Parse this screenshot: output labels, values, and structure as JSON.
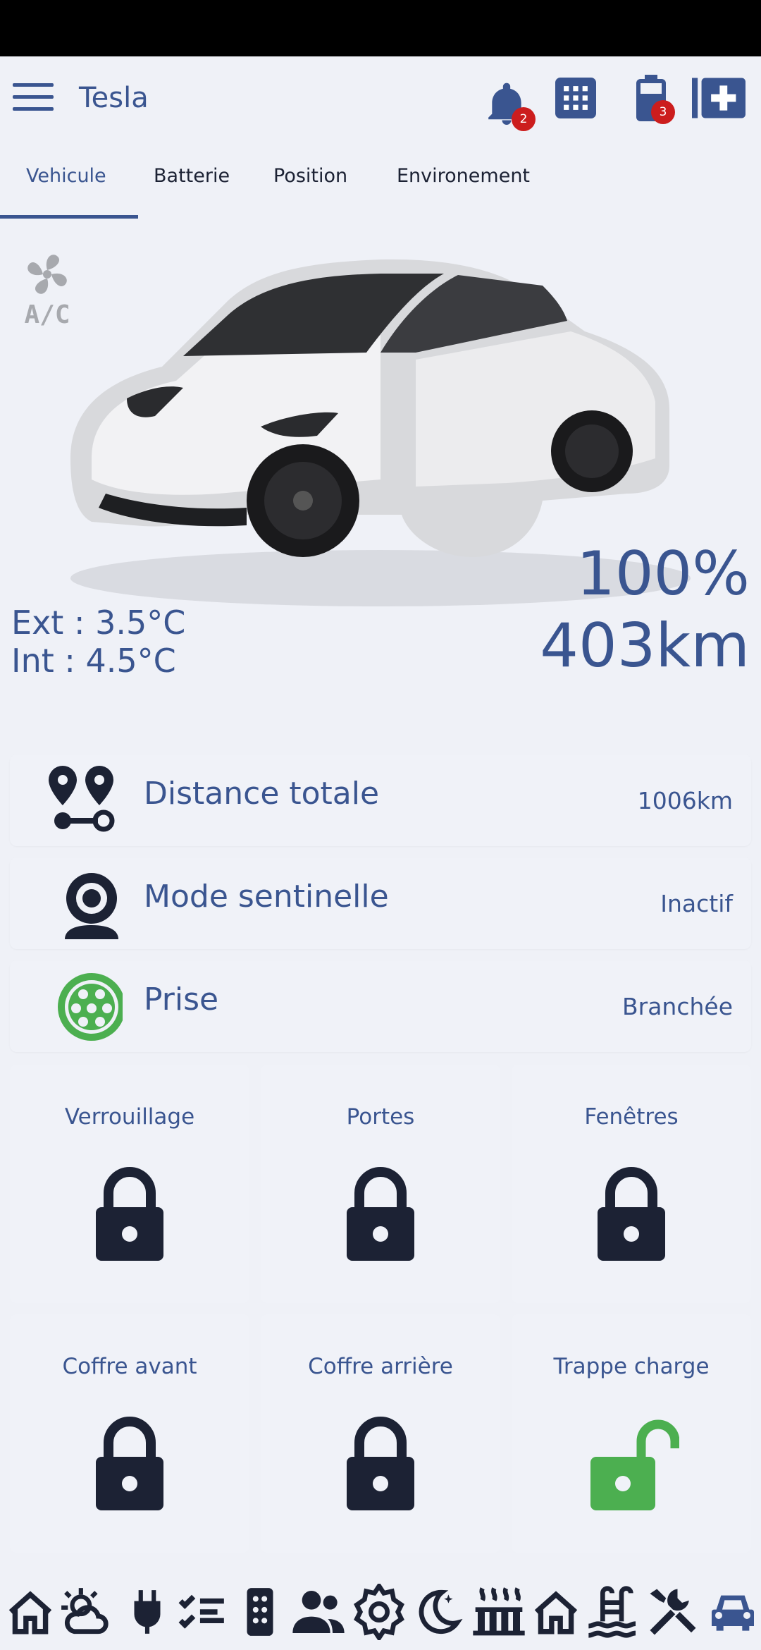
{
  "app": {
    "title": "Tesla"
  },
  "toolbar": {
    "notifications": {
      "icon": "bell-icon",
      "badge": "2"
    },
    "apps": {
      "icon": "grid-icon"
    },
    "battery": {
      "icon": "battery-icon",
      "badge": "3"
    },
    "add": {
      "icon": "add-box-icon"
    }
  },
  "tabs": [
    {
      "label": "Vehicule",
      "active": true
    },
    {
      "label": "Batterie"
    },
    {
      "label": "Position"
    },
    {
      "label": "Environement"
    }
  ],
  "vehicle": {
    "ac_icon": "ac-fan-icon",
    "temp_ext": "Ext : 3.5°C",
    "temp_int": "Int : 4.5°C",
    "charge_percent": "100%",
    "range": "403km"
  },
  "info_rows": [
    {
      "icon": "route-pins-icon",
      "label": "Distance totale",
      "value": "1006km"
    },
    {
      "icon": "webcam-icon",
      "label": "Mode sentinelle",
      "value": "Inactif"
    },
    {
      "icon": "ev-plug-icon",
      "label": "Prise",
      "value": "Branchée"
    }
  ],
  "locks": [
    {
      "label": "Verrouillage",
      "state": "locked"
    },
    {
      "label": "Portes",
      "state": "locked"
    },
    {
      "label": "Fenêtres",
      "state": "locked"
    },
    {
      "label": "Coffre avant",
      "state": "locked"
    },
    {
      "label": "Coffre arrière",
      "state": "locked"
    },
    {
      "label": "Trappe charge",
      "state": "unlocked"
    }
  ],
  "colors": {
    "primary": "#3a5590",
    "dark": "#1c2234",
    "green": "#4caf50",
    "badge": "#cc1d1d",
    "background": "#eff1f7"
  },
  "bottom_nav": [
    "home-icon",
    "weather-icon",
    "plug-icon",
    "checklist-icon",
    "remote-icon",
    "people-icon",
    "settings-icon",
    "night-icon",
    "heater-icon",
    "house-icon",
    "pool-icon",
    "tools-icon",
    "car-icon"
  ]
}
